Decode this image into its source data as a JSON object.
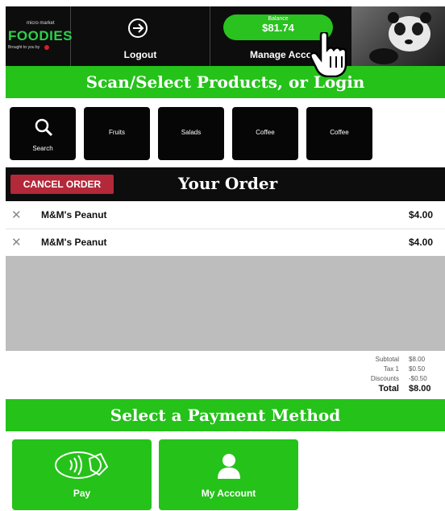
{
  "header": {
    "logo": {
      "top_text": "micro market",
      "brand": "FOODIES",
      "tagline": "Brought to you by"
    },
    "logout_label": "Logout",
    "balance_label": "Balance",
    "balance_value": "$81.74",
    "manage_account_label": "Manage Acco"
  },
  "scan_bar": {
    "title": "Scan/Select Products, or Login"
  },
  "categories": [
    {
      "label": "Search",
      "icon": "search-icon"
    },
    {
      "label": "Fruits"
    },
    {
      "label": "Salads"
    },
    {
      "label": "Coffee"
    },
    {
      "label": "Coffee"
    }
  ],
  "order": {
    "cancel_label": "CANCEL ORDER",
    "title": "Your Order",
    "items": [
      {
        "name": "M&M's Peanut",
        "price": "$4.00"
      },
      {
        "name": "M&M's Peanut",
        "price": "$4.00"
      }
    ]
  },
  "totals": {
    "subtotal_label": "Subtotal",
    "subtotal_value": "$8.00",
    "tax_label": "Tax 1",
    "tax_value": "$0.50",
    "discounts_label": "Discounts",
    "discounts_value": "-$0.50",
    "total_label": "Total",
    "total_value": "$8.00"
  },
  "payment_bar": {
    "title": "Select a Payment Method"
  },
  "payment": {
    "pay_label": "Pay",
    "my_account_label": "My Account"
  },
  "colors": {
    "accent_green": "#25c21a",
    "cancel_red": "#b3293a",
    "header_black": "#0d0d0d",
    "brand_green": "#2bd24a"
  }
}
